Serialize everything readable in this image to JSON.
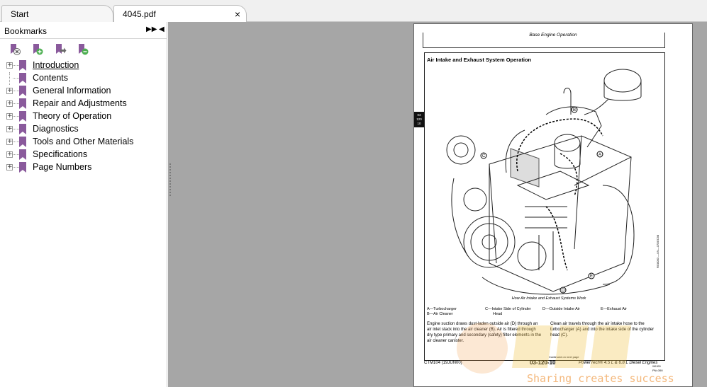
{
  "tabs": [
    {
      "label": "Start",
      "active": false
    },
    {
      "label": "4045.pdf",
      "active": true,
      "close": "×"
    }
  ],
  "panel": {
    "title": "Bookmarks",
    "expand_glyph": "▶▶",
    "collapse_glyph": "◀",
    "toolbar_icons": [
      "delete-bookmark-icon",
      "add-bookmark-icon",
      "go-to-bookmark-icon",
      "remove-bookmark-icon"
    ]
  },
  "bookmarks": [
    {
      "label": "Introduction",
      "expandable": true,
      "link": true
    },
    {
      "label": "Contents",
      "expandable": false,
      "link": false
    },
    {
      "label": "General Information",
      "expandable": true,
      "link": false
    },
    {
      "label": "Repair and Adjustments",
      "expandable": true,
      "link": false
    },
    {
      "label": "Theory of Operation",
      "expandable": true,
      "link": false
    },
    {
      "label": "Diagnostics",
      "expandable": true,
      "link": false
    },
    {
      "label": "Tools and Other Materials",
      "expandable": true,
      "link": false
    },
    {
      "label": "Specifications",
      "expandable": true,
      "link": false
    },
    {
      "label": "Page Numbers",
      "expandable": true,
      "link": false
    }
  ],
  "document": {
    "running_title": "Base Engine Operation",
    "section_title": "Air Intake and Exhaust System Operation",
    "side_tab": [
      "03",
      "120",
      "10"
    ],
    "figure_caption": "How Air Intake and Exhaust Systems Work",
    "figure_id": "RG8000 —UN—07DEC98",
    "legend": [
      "A—Turbocharger",
      "B—Air Cleaner",
      "C—Intake Side of Cylinder",
      "Head",
      "D—Outside Intake Air",
      "E—Exhaust Air"
    ],
    "callouts": [
      "B",
      "C",
      "A",
      "D",
      "E"
    ],
    "body_left": "Engine suction draws dust-laden outside air (D) through an air inlet stack into the air cleaner (B). Air is filtered through dry type primary and secondary (safety) filter elements in the air cleaner canister.",
    "body_right": "Clean air travels through the air intake hose to the turbocharger (A) and into the intake side of the cylinder head (C).",
    "continued": "Continued on next page",
    "footer_left": "CTM104 (19JUN00)",
    "footer_mid": "03-120-10",
    "footer_right": "PowerTech® 4.5 L & 6.8 L Diesel Engines",
    "footer_small": "PN=390",
    "footer_tiny": "061500"
  },
  "watermark": {
    "text": "Sharing creates success"
  },
  "colors": {
    "bookmark_icon": "#8a5a9c",
    "doc_background": "#a6a6a6",
    "watermark": "#f0a050"
  }
}
